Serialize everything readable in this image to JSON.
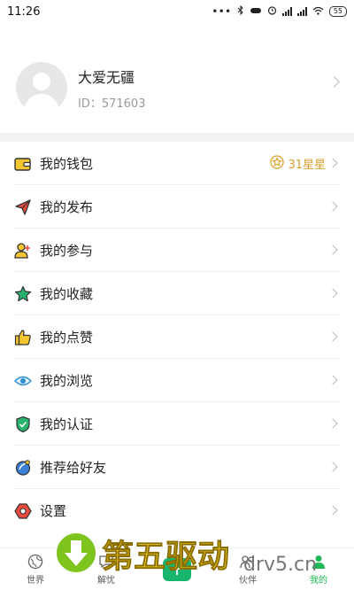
{
  "status_bar": {
    "time": "11:26",
    "dots": "•••",
    "battery": "55"
  },
  "profile": {
    "name": "大爱无疆",
    "id_text": "ID：571603"
  },
  "menu": [
    {
      "label": "我的钱包",
      "icon": "wallet-icon",
      "extra": "31星星",
      "extra_icon": "star-badge-icon"
    },
    {
      "label": "我的发布",
      "icon": "paper-plane-icon"
    },
    {
      "label": "我的参与",
      "icon": "person-add-icon"
    },
    {
      "label": "我的收藏",
      "icon": "star-icon"
    },
    {
      "label": "我的点赞",
      "icon": "thumbs-up-icon"
    },
    {
      "label": "我的浏览",
      "icon": "eye-icon"
    },
    {
      "label": "我的认证",
      "icon": "shield-check-icon"
    },
    {
      "label": "推荐给好友",
      "icon": "share-icon"
    },
    {
      "label": "设置",
      "icon": "settings-icon"
    }
  ],
  "tabbar": {
    "tabs": [
      {
        "label": "世界",
        "icon": "globe-icon"
      },
      {
        "label": "解忧",
        "icon": "chat-icon"
      },
      {
        "label": "",
        "icon": "plus-icon"
      },
      {
        "label": "伙伴",
        "icon": "partner-icon"
      },
      {
        "label": "我的",
        "icon": "profile-icon"
      }
    ],
    "active": "我的"
  },
  "watermark": {
    "text": "第五驱动",
    "domain": "drv5.cn"
  },
  "colors": {
    "accent": "#1db954",
    "star": "#d9a12f",
    "plus": "#19b46e"
  }
}
